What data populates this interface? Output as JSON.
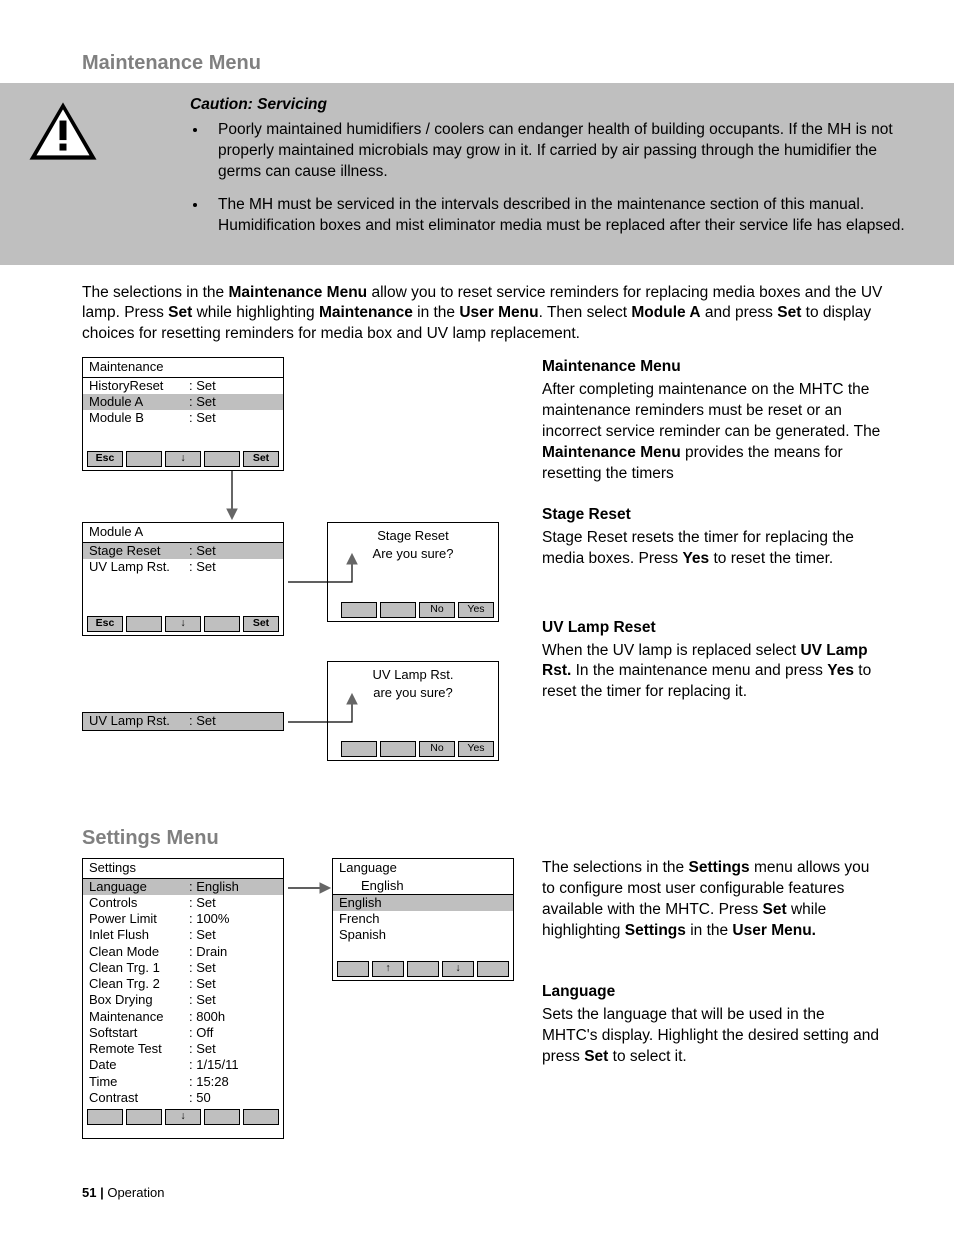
{
  "section1_title": "Maintenance Menu",
  "caution": {
    "heading": "Caution: Servicing",
    "bullets": [
      "Poorly maintained humidifiers / coolers can endanger health of building occupants. If the MH is not properly maintained microbials may grow in it.  If carried by air passing through the humidifier the germs can cause illness.",
      "The MH must be serviced in the intervals described in the maintenance section of this manual. Humidification boxes and mist eliminator media must be replaced after their service life has elapsed."
    ]
  },
  "intro": {
    "t1": "The selections in the ",
    "b1": "Maintenance Menu",
    "t2": " allow you to reset service reminders for replacing media boxes and the UV lamp.  Press ",
    "b2": "Set",
    "t3": " while highlighting ",
    "b3": "Maintenance",
    "t4": " in the ",
    "b4": "User Menu",
    "t5": ".  Then select ",
    "b5": "Module A",
    "t6": " and press ",
    "b6": "Set",
    "t7": " to display choices for resetting reminders for media box and UV lamp replacement."
  },
  "maint_panel": {
    "title": "Maintenance",
    "rows": [
      {
        "k": "HistoryReset",
        "v": ": Set",
        "sel": false
      },
      {
        "k": "Module A",
        "v": ": Set",
        "sel": true
      },
      {
        "k": "Module B",
        "v": ": Set",
        "sel": false
      }
    ],
    "buttons": {
      "esc": "Esc",
      "set": "Set"
    }
  },
  "moda_panel": {
    "title": "Module A",
    "rows": [
      {
        "k": "Stage Reset",
        "v": ": Set",
        "sel": true
      },
      {
        "k": "UV Lamp Rst.",
        "v": ": Set",
        "sel": false
      }
    ],
    "buttons": {
      "esc": "Esc",
      "set": "Set"
    }
  },
  "uv_row": {
    "k": "UV Lamp Rst.",
    "v": ": Set"
  },
  "confirm1": {
    "line1": "Stage Reset",
    "line2": "Are you sure?",
    "no": "No",
    "yes": "Yes"
  },
  "confirm2": {
    "line1": "UV Lamp Rst.",
    "line2": "are you sure?",
    "no": "No",
    "yes": "Yes"
  },
  "right_blocks": [
    {
      "h": "Maintenance Menu",
      "pre": "After completing maintenance on the MHTC the maintenance reminders must be reset or an incorrect service reminder can be generated.  The ",
      "bold": "Maintenance Menu",
      "post": " provides the means for resetting the timers"
    },
    {
      "h": "Stage Reset",
      "pre": "Stage Reset  resets the timer for replacing the media boxes.  Press ",
      "bold": "Yes",
      "post": " to reset the timer."
    },
    {
      "h": "UV Lamp Reset",
      "pre": "When the UV lamp is replaced select ",
      "bold": "UV Lamp Rst.",
      "mid": " In the maintenance menu and press ",
      "bold2": "Yes",
      "post": " to reset the timer for replacing it."
    }
  ],
  "section2_title": "Settings Menu",
  "settings_panel": {
    "title": "Settings",
    "rows": [
      {
        "k": "Language",
        "v": ": English",
        "sel": true
      },
      {
        "k": "Controls",
        "v": ": Set"
      },
      {
        "k": "Power Limit",
        "v": ": 100%"
      },
      {
        "k": "Inlet Flush",
        "v": ": Set"
      },
      {
        "k": "Clean Mode",
        "v": ": Drain"
      },
      {
        "k": "Clean Trg. 1",
        "v": ": Set"
      },
      {
        "k": "Clean Trg. 2",
        "v": ": Set"
      },
      {
        "k": "Box Drying",
        "v": ": Set"
      },
      {
        "k": "Maintenance",
        "v": ": 800h"
      },
      {
        "k": "Softstart",
        "v": ": Off"
      },
      {
        "k": "Remote Test",
        "v": ": Set"
      },
      {
        "k": "Date",
        "v": ": 1/15/11"
      },
      {
        "k": "Time",
        "v": ": 15:28"
      },
      {
        "k": "Contrast",
        "v": ": 50"
      }
    ]
  },
  "lang_panel": {
    "title": "Language",
    "rows": [
      {
        "k": "English",
        "sel": true,
        "indent": true
      },
      {
        "k": "English",
        "sel": true
      },
      {
        "k": "French"
      },
      {
        "k": "Spanish"
      }
    ]
  },
  "settings_intro": {
    "t1": "The selections in the ",
    "b1": "Settings",
    "t2": " menu allows you to configure most user configurable features available with the MHTC.  Press ",
    "b2": "Set",
    "t3": " while highlighting ",
    "b3": "Settings",
    "t4": " in the ",
    "b4": "User Menu."
  },
  "language_block": {
    "h": "Language",
    "pre": "Sets the language that will be used in the MHTC's display.  Highlight the desired setting and press ",
    "bold": "Set",
    "post": " to select it."
  },
  "footer": {
    "page": "51 |",
    "section": " Operation"
  }
}
